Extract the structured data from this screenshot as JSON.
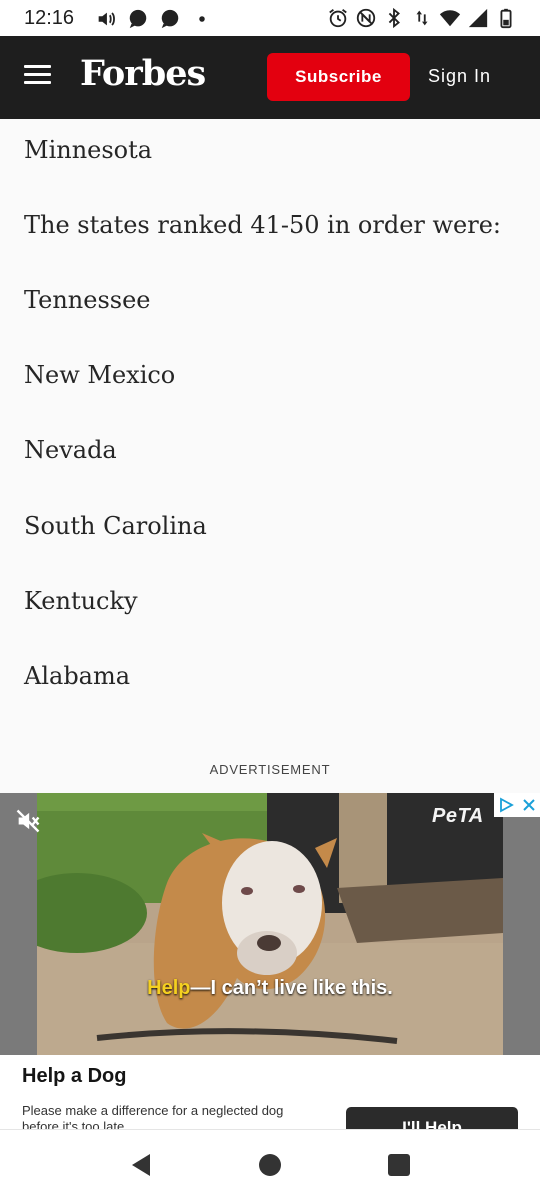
{
  "status_bar": {
    "time": "12:16",
    "left_icons": [
      "volume-icon",
      "chat-bubble-icon",
      "chat-bubble-icon",
      "dot-icon"
    ],
    "right_icons": [
      "alarm-icon",
      "nfc-icon",
      "bluetooth-icon",
      "data-arrows-icon",
      "wifi-icon",
      "signal-icon",
      "battery-icon"
    ]
  },
  "header": {
    "brand": "Forbes",
    "subscribe_label": "Subscribe",
    "signin_label": "Sign In",
    "bg_color": "#1e1e1e",
    "accent_color": "#e3000f"
  },
  "article": {
    "paragraphs": [
      "Minnesota",
      "The states ranked 41-50 in order were:",
      "Tennessee",
      "New Mexico",
      "Nevada",
      "South Carolina",
      "Kentucky",
      "Alabama"
    ]
  },
  "advertisement": {
    "label": "ADVERTISEMENT",
    "brand_logo": "PeTA",
    "caption_highlight": "Help",
    "caption_rest": "—I can’t live like this.",
    "title": "Help a Dog",
    "description": "Please make a difference for a neglected dog before it's too late.",
    "cta_label": "I'll Help",
    "highlight_color": "#f5d020"
  },
  "nav_bar": {
    "buttons": [
      "back-icon",
      "home-icon",
      "recents-icon"
    ]
  }
}
